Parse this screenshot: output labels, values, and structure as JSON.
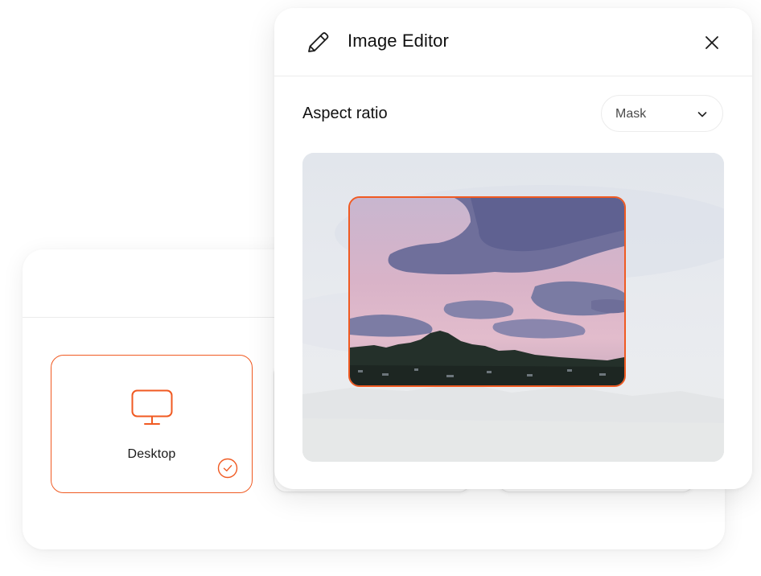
{
  "editor": {
    "title": "Image Editor",
    "icons": {
      "edit": "pencil-icon",
      "close": "close-icon"
    },
    "aspect_ratio_label": "Aspect ratio",
    "mask_select": {
      "value": "Mask",
      "icon": "chevron-down-icon"
    },
    "crop_frame_color": "#f05a22"
  },
  "devices": {
    "items": [
      {
        "label": "Desktop",
        "icon": "monitor-icon",
        "selected": true,
        "check_icon": "checkmark-circle-icon"
      }
    ]
  },
  "colors": {
    "accent": "#f05a22",
    "divider": "#ececec",
    "text": "#111111"
  }
}
